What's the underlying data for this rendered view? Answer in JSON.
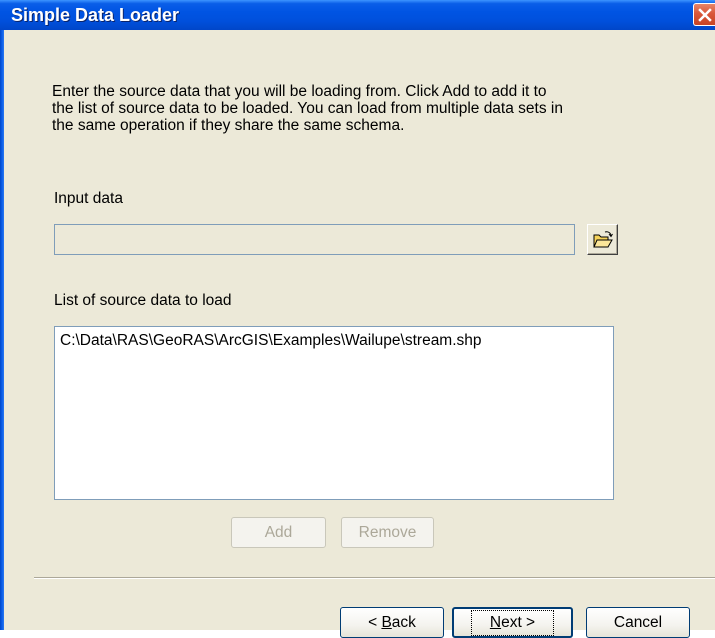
{
  "window": {
    "title": "Simple Data Loader"
  },
  "instructions": [
    "Enter the source data that you will be loading from. Click Add to add it to",
    "the list of source data to be loaded. You can load from multiple data sets in",
    "the same operation if they share the same schema."
  ],
  "input": {
    "label": "Input data",
    "value": "",
    "browse_icon": "open-folder-icon"
  },
  "source_list": {
    "label": "List of source data to load",
    "items": [
      "C:\\Data\\RAS\\GeoRAS\\ArcGIS\\Examples\\Wailupe\\stream.shp"
    ]
  },
  "list_buttons": {
    "add": "Add",
    "remove": "Remove"
  },
  "nav_buttons": {
    "back_prefix": "< ",
    "back_mnemonic": "B",
    "back_rest": "ack",
    "next_mnemonic": "N",
    "next_rest": "ext >",
    "cancel": "Cancel"
  },
  "colors": {
    "titlebar": "#0054e3",
    "dialog_bg": "#ece9d8",
    "close_button": "#d9573a",
    "field_border": "#7f9db9"
  }
}
